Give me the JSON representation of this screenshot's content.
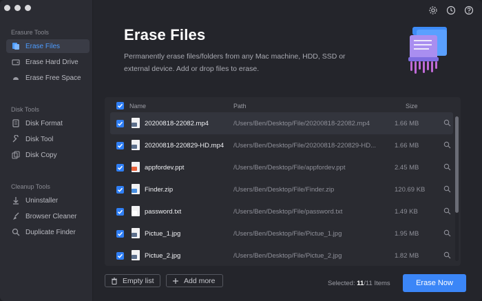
{
  "sidebar": {
    "sections": [
      {
        "heading": "Erasure Tools",
        "items": [
          {
            "label": "Erase Files",
            "icon": "erase-files-icon",
            "active": true
          },
          {
            "label": "Erase Hard Drive",
            "icon": "hard-drive-icon"
          },
          {
            "label": "Erase Free Space",
            "icon": "free-space-icon"
          }
        ]
      },
      {
        "heading": "Disk Tools",
        "items": [
          {
            "label": "Disk Format",
            "icon": "disk-format-icon"
          },
          {
            "label": "Disk Tool",
            "icon": "disk-tool-icon"
          },
          {
            "label": "Disk Copy",
            "icon": "disk-copy-icon"
          }
        ]
      },
      {
        "heading": "Cleanup Tools",
        "items": [
          {
            "label": "Uninstaller",
            "icon": "uninstaller-icon"
          },
          {
            "label": "Browser Cleaner",
            "icon": "browser-cleaner-icon"
          },
          {
            "label": "Duplicate Finder",
            "icon": "duplicate-finder-icon"
          }
        ]
      }
    ]
  },
  "header": {
    "title": "Erase Files",
    "description": "Permanently erase files/folders from any Mac machine, HDD, SSD or external device. Add or drop files to erase."
  },
  "table": {
    "columns": {
      "name": "Name",
      "path": "Path",
      "size": "Size"
    },
    "rows": [
      {
        "name": "20200818-22082.mp4",
        "path": "/Users/Ben/Desktop/File/20200818-22082.mp4",
        "size": "1.66 MB",
        "type": "video"
      },
      {
        "name": "20200818-220829-HD.mp4",
        "path": "/Users/Ben/Desktop/File/20200818-220829-HD...",
        "size": "1.66 MB",
        "type": "video"
      },
      {
        "name": "appfordev.ppt",
        "path": "/Users/Ben/Desktop/File/appfordev.ppt",
        "size": "2.45 MB",
        "type": "ppt"
      },
      {
        "name": "Finder.zip",
        "path": "/Users/Ben/Desktop/File/Finder.zip",
        "size": "120.69 KB",
        "type": "zip"
      },
      {
        "name": "password.txt",
        "path": "/Users/Ben/Desktop/File/password.txt",
        "size": "1.49 KB",
        "type": "txt"
      },
      {
        "name": "Pictue_1.jpg",
        "path": "/Users/Ben/Desktop/File/Pictue_1.jpg",
        "size": "1.95 MB",
        "type": "image"
      },
      {
        "name": "Pictue_2.jpg",
        "path": "/Users/Ben/Desktop/File/Pictue_2.jpg",
        "size": "1.82 MB",
        "type": "image"
      }
    ]
  },
  "footer": {
    "empty_label": "Empty list",
    "add_label": "Add more",
    "selected_prefix": "Selected: ",
    "selected_count": "11",
    "selected_total": "/11 Items",
    "erase_label": "Erase Now"
  },
  "colors": {
    "accent": "#3b86f7",
    "checkbox": "#2f7ff6",
    "active_item_text": "#4d9cff",
    "background": "#24252b",
    "sidebar": "#2b2c33"
  }
}
